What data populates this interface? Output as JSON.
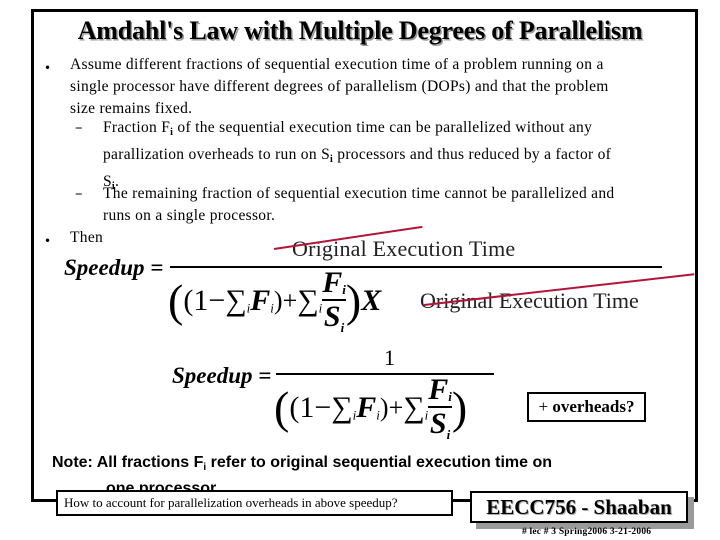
{
  "slide": {
    "title": "Amdahl's Law with Multiple Degrees of Parallelism",
    "bullets": [
      {
        "lines": [
          "Assume different fractions of sequential execution time of a problem running on a",
          "single processor  have different degrees of parallelism (DOPs) and that the problem",
          "size remains fixed."
        ]
      }
    ],
    "sub_bullets": [
      {
        "line1_a": "Fraction  F",
        "line1_sub": "i",
        "line1_b": "  of the sequential execution time can be parallelized without any",
        "line2_a": "parallization overheads to run on S",
        "line2_sub": "i",
        "line2_b": " processors and thus reduced by a factor of",
        "line3_a": "S",
        "line3_sub": "i",
        "line3_b": "."
      },
      {
        "line1": "The remaining fraction of sequential execution time cannot be parallelized and",
        "line2": "runs on a single processor."
      }
    ],
    "then_label": "Then",
    "bullet_glyph": "•",
    "dash_glyph": "–"
  },
  "formula1": {
    "lhs": "Speedup =",
    "numerator": "Original  Execution   Time",
    "one_minus": "(1−",
    "sigma": "∑",
    "index": "i",
    "F": "F",
    "S": "S",
    "close_plus": ")+",
    "X": "X",
    "times_text": "Original  Execution  Time",
    "strike_color": "#b3143c"
  },
  "formula2": {
    "lhs": "Speedup =",
    "numerator": "1"
  },
  "overheads_box": {
    "plus": "+ ",
    "label": "overheads?"
  },
  "note": {
    "prefix": "Note:  All fractions F",
    "sub": "i",
    "rest": " refer to original sequential execution time on",
    "line2": "one processor."
  },
  "footer": {
    "question": "How to account for parallelization overheads in above speedup?",
    "brand": "EECC756 - Shaaban",
    "lecture_info": "#  lec # 3   Spring2006   3-21-2006"
  }
}
